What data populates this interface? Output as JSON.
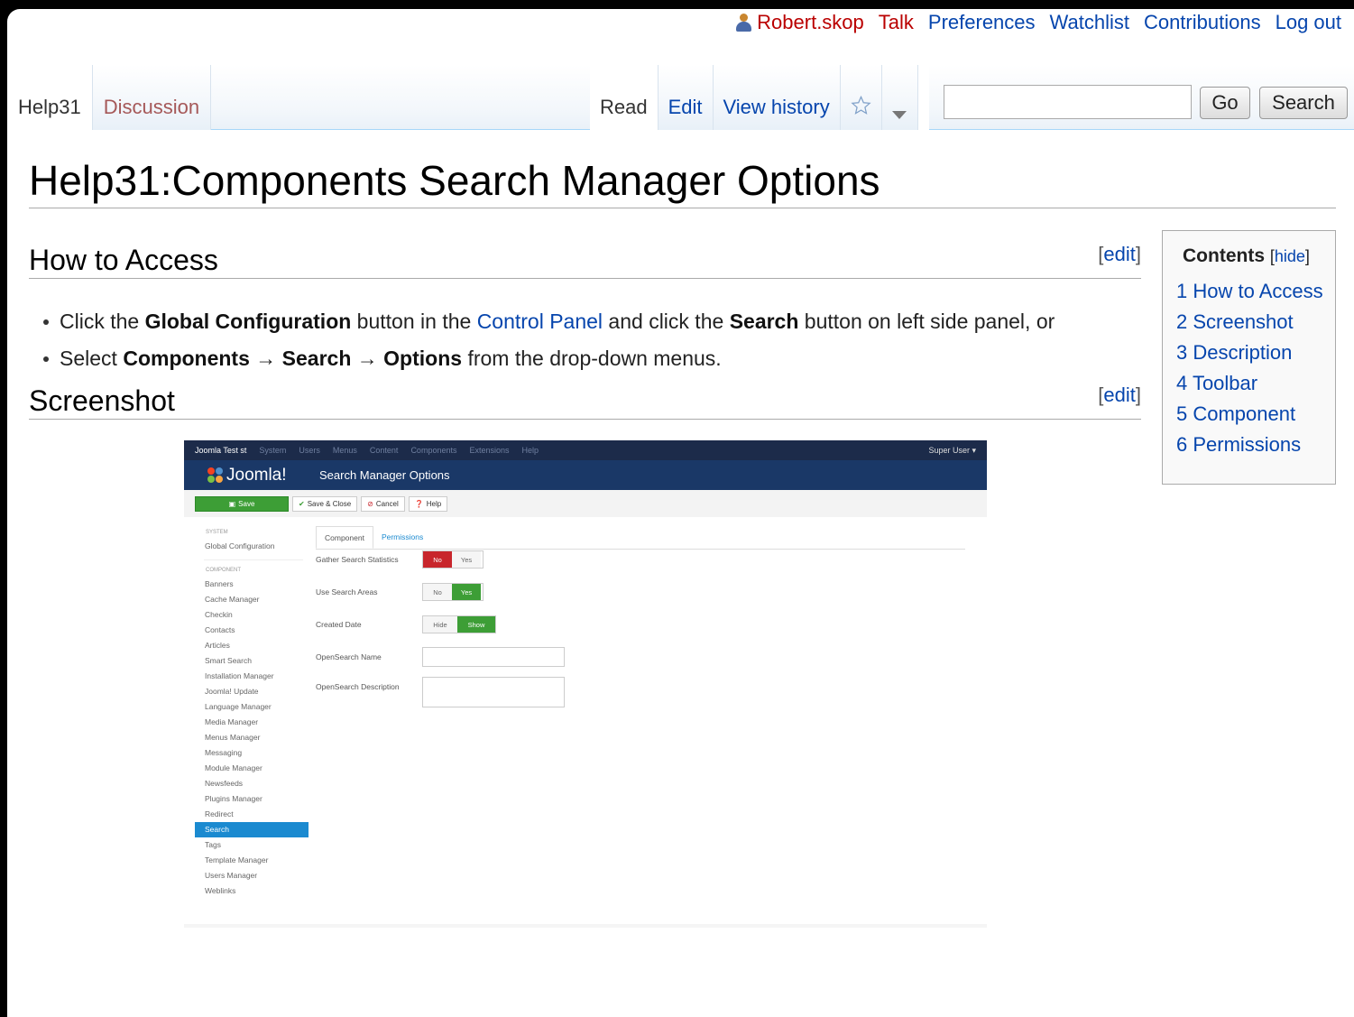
{
  "personal": {
    "user": "Robert.skop",
    "talk": "Talk",
    "preferences": "Preferences",
    "watchlist": "Watchlist",
    "contributions": "Contributions",
    "logout": "Log out"
  },
  "tabs": {
    "page": "Help31",
    "discussion": "Discussion",
    "read": "Read",
    "edit": "Edit",
    "history": "View history"
  },
  "search": {
    "value": "",
    "go": "Go",
    "search": "Search"
  },
  "title": "Help31:Components Search Manager Options",
  "sections": {
    "access": {
      "heading": "How to Access",
      "edit": "edit"
    },
    "screenshot": {
      "heading": "Screenshot",
      "edit": "edit"
    }
  },
  "access_list": [
    {
      "t1": "Click the ",
      "b1": "Global Configuration",
      "t2": " button in the ",
      "link": "Control Panel",
      "t3": " and click the ",
      "b2": "Search",
      "t4": " button on left side panel, or"
    },
    {
      "t1": "Select ",
      "b1": "Components",
      "a1": " → ",
      "b2": "Search",
      "a2": " → ",
      "b3": "Options",
      "t2": " from the drop-down menus."
    }
  ],
  "toc": {
    "title": "Contents",
    "hide": "hide",
    "items": [
      "1 How to Access",
      "2 Screenshot",
      "3 Description",
      "4 Toolbar",
      "5 Component",
      "6 Permissions"
    ]
  },
  "joomla": {
    "site": "Joomla Test st",
    "menu": [
      "System",
      "Users",
      "Menus",
      "Content",
      "Components",
      "Extensions",
      "Help"
    ],
    "user": "Super User ▾",
    "logo": "Joomla!",
    "title": "Search Manager Options",
    "toolbar": {
      "save": "Save",
      "save_close": "Save & Close",
      "cancel": "Cancel",
      "help": "Help"
    },
    "sidebar": {
      "system_header": "SYSTEM",
      "global": "Global Configuration",
      "component_header": "COMPONENT",
      "items": [
        "Banners",
        "Cache Manager",
        "Checkin",
        "Contacts",
        "Articles",
        "Smart Search",
        "Installation Manager",
        "Joomla! Update",
        "Language Manager",
        "Media Manager",
        "Menus Manager",
        "Messaging",
        "Module Manager",
        "Newsfeeds",
        "Plugins Manager",
        "Redirect",
        "Search",
        "Tags",
        "Template Manager",
        "Users Manager",
        "Weblinks"
      ],
      "active": "Search"
    },
    "tabs": [
      "Component",
      "Permissions"
    ],
    "fields": {
      "gather": {
        "label": "Gather Search Statistics",
        "opt1": "No",
        "opt2": "Yes"
      },
      "areas": {
        "label": "Use Search Areas",
        "opt1": "No",
        "opt2": "Yes"
      },
      "created": {
        "label": "Created Date",
        "opt1": "Hide",
        "opt2": "Show"
      },
      "os_name": {
        "label": "OpenSearch Name"
      },
      "os_desc": {
        "label": "OpenSearch Description"
      }
    }
  },
  "colors": {
    "link": "#0645ad",
    "redlink": "#ba0000",
    "joomla_nav": "#1a3867",
    "joomla_green": "#3d9e36",
    "joomla_red": "#c8262c",
    "joomla_active": "#1b8ad0"
  }
}
